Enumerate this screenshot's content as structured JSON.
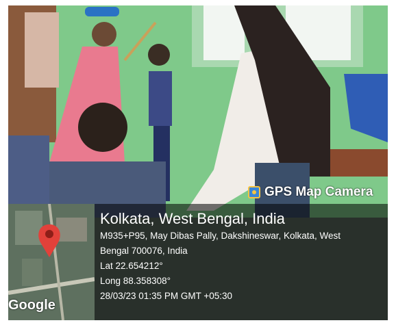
{
  "overlay": {
    "brand": "GPS Map Camera",
    "place": "Kolkata, West Bengal, India",
    "address_line1": "M935+P95, May Dibas Pally, Dakshineswar, Kolkata, West",
    "address_line2": "Bengal 700076, India",
    "lat": "Lat 22.654212°",
    "long": "Long 88.358308°",
    "datetime": "28/03/23 01:35 PM GMT +05:30",
    "map_provider": "Google"
  },
  "colors": {
    "wall_green": "#7fc98a",
    "pin_red": "#e2413a",
    "panel": "#000000"
  },
  "icons": {
    "camera": "gps-camera-icon",
    "pin": "map-pin-icon"
  }
}
